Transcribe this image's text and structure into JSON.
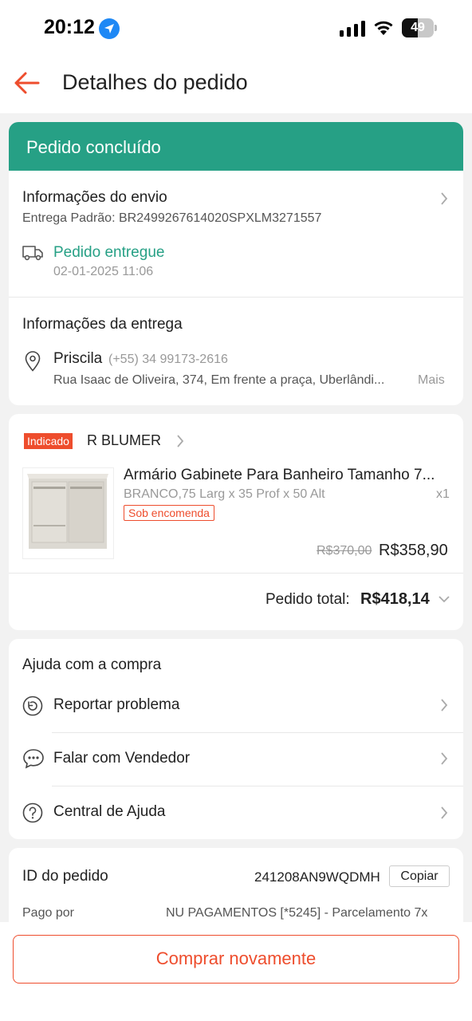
{
  "status_bar": {
    "time": "20:12",
    "battery": "49",
    "battery_level": 0.49
  },
  "header": {
    "title": "Detalhes do pedido"
  },
  "order_status": {
    "banner": "Pedido concluído",
    "shipping": {
      "title": "Informações do envio",
      "tracking": "Entrega Padrão: BR2499267614020SPXLM3271557",
      "status": "Pedido entregue",
      "date": "02-01-2025 11:06"
    },
    "delivery": {
      "title": "Informações da entrega",
      "name": "Priscila",
      "phone": "(+55) 34 99173-2616",
      "address": "Rua Isaac de Oliveira, 374, Em frente a praça, Uberlândi...",
      "more": "Mais"
    }
  },
  "shop": {
    "badge": "Indicado",
    "name": "R BLUMER",
    "product": {
      "title": "Armário Gabinete Para Banheiro Tamanho 7...",
      "variant": "BRANCO,75 Larg x 35 Prof x 50 Alt",
      "qty": "x1",
      "tag": "Sob encomenda",
      "old_price": "R$370,00",
      "price": "R$358,90"
    },
    "total_label": "Pedido total:",
    "total_value": "R$418,14"
  },
  "help": {
    "title": "Ajuda com a compra",
    "items": [
      {
        "label": "Reportar problema",
        "icon": "report-icon"
      },
      {
        "label": "Falar com Vendedor",
        "icon": "chat-icon"
      },
      {
        "label": "Central de Ajuda",
        "icon": "help-icon"
      }
    ]
  },
  "order_info": {
    "id_label": "ID do pedido",
    "id_value": "241208AN9WQDMH",
    "copy": "Copiar",
    "paid_label": "Pago por",
    "paid_value": "NU PAGAMENTOS [*5245] - Parcelamento 7x"
  },
  "footer": {
    "rebuy": "Comprar novamente"
  },
  "colors": {
    "accent": "#ee4d2d",
    "success": "#26a085"
  }
}
